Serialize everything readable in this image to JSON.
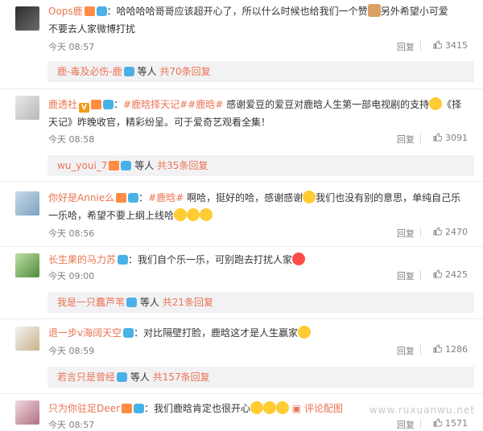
{
  "comments": [
    {
      "username": "Oops鹿",
      "text_1": "：哈哈哈哈哥哥应该超开心了，所以什么时候也给我们一个赞",
      "text_2": "另外希望小可爱",
      "text_line2": "不要去人家微博打扰",
      "time": "今天 08:57",
      "reply_label": "回复",
      "likes": "3415"
    },
    {
      "username": "鹿透社",
      "tag_1": "#鹿晗择天记#",
      "tag_2": "#鹿晗#",
      "text_1": "感谢爱豆的爱豆对鹿晗人生第一部电视剧的支持",
      "text_2": "《择",
      "text_line2": "天记》昨晚收官，精彩纷呈。可于爱奇艺观看全集！",
      "time": "今天 08:58",
      "reply_label": "回复",
      "likes": "3091"
    },
    {
      "username": "你好是Annie么",
      "tag_1": "#鹿晗#",
      "text_1": "啊哈，挺好的哈，感谢感谢",
      "text_2": "我们也没有别的意思，单纯自己乐",
      "text_line2": "一乐哈，希望不要上纲上线哈",
      "time": "今天 08:56",
      "reply_label": "回复",
      "likes": "2470"
    },
    {
      "username": "长生果的马力苏",
      "text_1": "：我们自个乐一乐，可别跑去打扰人家",
      "time": "今天 09:00",
      "reply_label": "回复",
      "likes": "2425"
    },
    {
      "username": "退一步v海阔天空",
      "text_1": "：对比隔壁打脸，鹿晗这才是人生赢家",
      "time": "今天 08:59",
      "reply_label": "回复",
      "likes": "1286"
    },
    {
      "username": "只为你驻足Deer",
      "text_1": "：我们鹿晗肯定也很开心",
      "comment_label": "评论配图",
      "time": "今天 08:57",
      "reply_label": "回复",
      "likes": "1571"
    }
  ],
  "replies": [
    {
      "username": "鹿-毒及必伤-鹿",
      "label": "等人",
      "count_link": "共70条回复"
    },
    {
      "username": "wu_youi_7",
      "label": "等人",
      "count_link": "共35条回复"
    },
    {
      "username": "我是一只蠢芦苇",
      "label": "等人",
      "count_link": "共21条回复"
    },
    {
      "username": "若言只是曾经",
      "label": "等人",
      "count_link": "共157条回复"
    }
  ],
  "watermark": "www.ruxuanwu.net",
  "colors": {
    "accent": "#eb7350",
    "text": "#333333",
    "meta": "#808080",
    "reply_bg": "#f2f2f5"
  },
  "icons": [
    "avatar",
    "vip-badge",
    "camera-badge",
    "thumbs-up-icon",
    "emoji-icon"
  ]
}
